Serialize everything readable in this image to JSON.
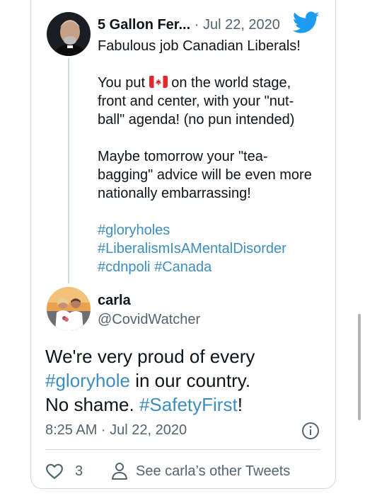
{
  "parent_tweet": {
    "name": "5 Gallon Fer...",
    "separator": "·",
    "date": "Jul 22, 2020",
    "line1": "Fabulous job Canadian Liberals!",
    "para2_before_flag": "You put",
    "para2_after_flag": "on the world stage, front and center, with your \"nut-ball\" agenda!  (no pun intended)",
    "para3": "Maybe tomorrow your \"tea-bagging\" advice will be even more nationally embarrassing!",
    "hashtags": {
      "tag1": "#gloryholes",
      "tag2": "#LiberalismIsAMentalDisorder",
      "tag3": "#cdnpoli",
      "tag4": "#Canada"
    },
    "flag_icon": "canada-flag-icon",
    "source_icon": "twitter-bird-icon"
  },
  "reply_tweet": {
    "name": "carla",
    "handle": "@CovidWatcher",
    "text_line1": "We're very proud of every",
    "text_hashtag1": "#gloryhole",
    "text_line2_rest": "in our country.",
    "text_line3_start": "No shame.",
    "text_hashtag2": "#SafetyFirst",
    "text_line3_end": "!",
    "timestamp": "8:25 AM · Jul 22, 2020",
    "like_count": "3",
    "see_other_label": "See carla’s other Tweets"
  },
  "colors": {
    "link": "#3d8ebf",
    "muted": "#536471",
    "twitter_blue": "#1d9bf0",
    "border": "#cfd9de"
  }
}
